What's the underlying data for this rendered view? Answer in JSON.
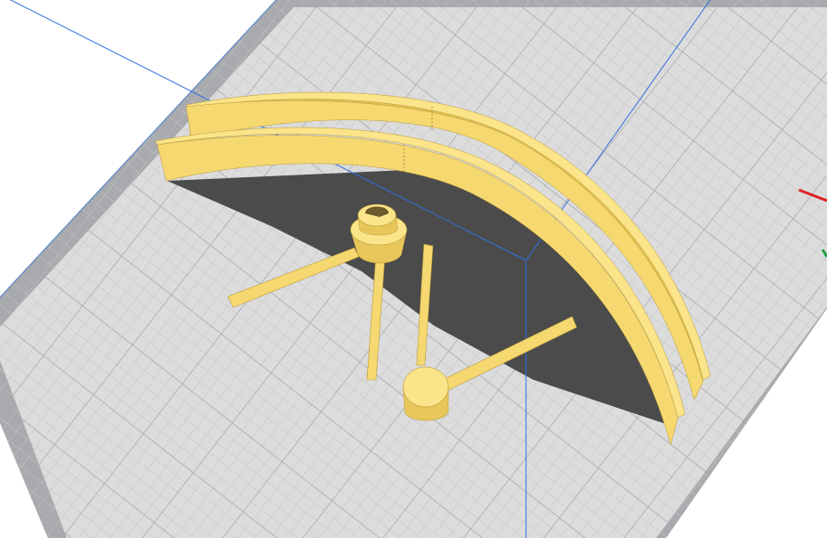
{
  "viewport": {
    "background": "#ffffff",
    "build_plate": {
      "border_color": "#a8aaad",
      "surface_color": "#dcdcdc",
      "minor_grid_color": "#c4c4c4",
      "major_grid_color": "#9ea1a5",
      "outline_color": "#6e8fc8",
      "grid": true
    },
    "build_volume_line_color": "#2f6fe0",
    "model": {
      "color": "#f5d870",
      "edge_color": "#b89a3a",
      "shadow_color": "#4b4b4b",
      "parts": [
        {
          "name": "outer-arc-brace"
        },
        {
          "name": "inner-arc-brace"
        },
        {
          "name": "slotted-hub"
        },
        {
          "name": "round-hub"
        },
        {
          "name": "left-strut"
        },
        {
          "name": "center-left-strut"
        },
        {
          "name": "center-right-strut"
        },
        {
          "name": "right-strut"
        }
      ]
    },
    "axis_indicator": {
      "x_color": "#e02020",
      "z_color": "#20a040"
    }
  }
}
